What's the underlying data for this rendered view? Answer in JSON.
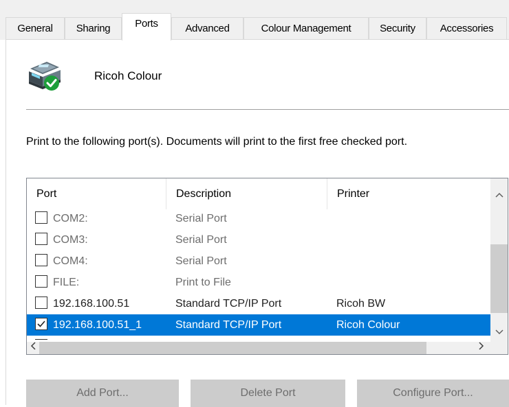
{
  "tabs": [
    {
      "label": "General"
    },
    {
      "label": "Sharing"
    },
    {
      "label": "Ports",
      "active": true
    },
    {
      "label": "Advanced"
    },
    {
      "label": "Colour Management"
    },
    {
      "label": "Security"
    },
    {
      "label": "Accessories"
    }
  ],
  "printer": {
    "name": "Ricoh Colour",
    "icon": "printer-ready-icon"
  },
  "instructions": "Print to the following port(s). Documents will print to the first free checked port.",
  "port_list": {
    "columns": [
      "Port",
      "Description",
      "Printer"
    ],
    "rows": [
      {
        "port": "COM2:",
        "description": "Serial Port",
        "printer": "",
        "checked": false
      },
      {
        "port": "COM3:",
        "description": "Serial Port",
        "printer": "",
        "checked": false
      },
      {
        "port": "COM4:",
        "description": "Serial Port",
        "printer": "",
        "checked": false
      },
      {
        "port": "FILE:",
        "description": "Print to File",
        "printer": "",
        "checked": false
      },
      {
        "port": "192.168.100.51",
        "description": "Standard TCP/IP Port",
        "printer": "Ricoh BW",
        "checked": false
      },
      {
        "port": "192.168.100.51_1",
        "description": "Standard TCP/IP Port",
        "printer": "Ricoh Colour",
        "checked": true,
        "selected": true
      }
    ],
    "scroll_icons": {
      "up": "chevron-up-icon",
      "down": "chevron-down-icon",
      "left": "chevron-left-icon",
      "right": "chevron-right-icon"
    }
  },
  "buttons": {
    "add_port": "Add Port...",
    "delete_port": "Delete Port",
    "configure_port": "Configure Port..."
  },
  "colors": {
    "selection": "#0078d7",
    "button_disabled_bg": "#cccccc",
    "check_green": "#1d9e3b"
  }
}
